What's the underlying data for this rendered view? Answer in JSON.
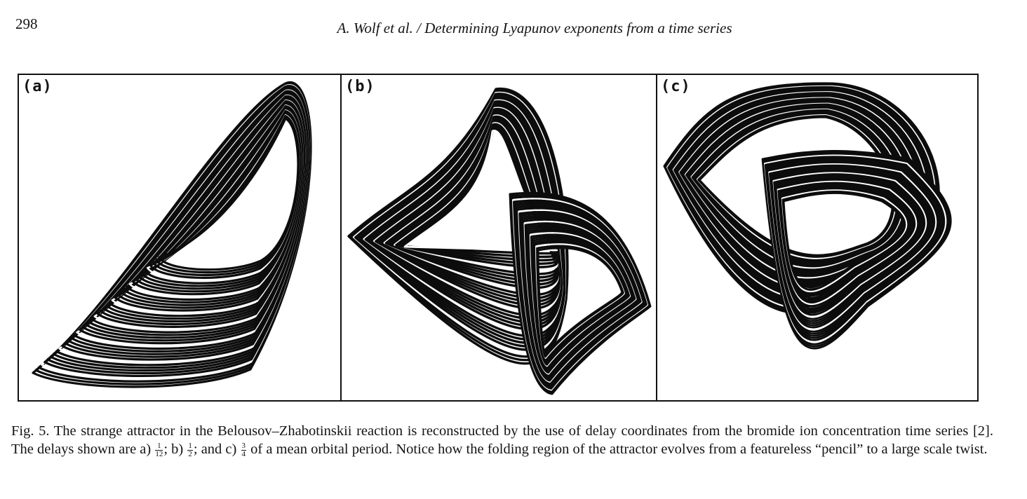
{
  "header": {
    "page_number": "298",
    "running_title": "A. Wolf et al. / Determining Lyapunov exponents from a time series"
  },
  "figure": {
    "panels": [
      {
        "label": "(a)"
      },
      {
        "label": "(b)"
      },
      {
        "label": "(c)"
      }
    ]
  },
  "caption": {
    "part1": "Fig. 5. The strange attractor in the Belousov–Zhabotinskii reaction is reconstructed by the use of delay coordinates from the bromide ion concentration time series [2]. The delays shown are a)",
    "frac_a_num": "1",
    "frac_a_den": "12",
    "part2": "; b)",
    "frac_b_num": "1",
    "frac_b_den": "2",
    "part3": "; and c)",
    "frac_c_num": "3",
    "frac_c_den": "4",
    "part4": "of a mean orbital period. Notice how the folding region of the attractor evolves from a featureless “pencil” to a large scale twist."
  }
}
